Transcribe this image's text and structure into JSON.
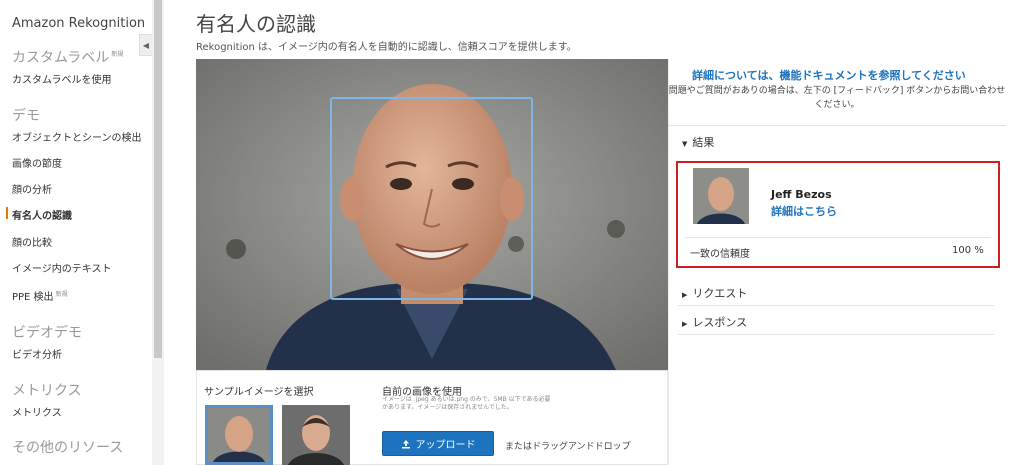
{
  "sidebar": {
    "brand": "Amazon Rekognition",
    "new_badge": "新規",
    "collapse_icon": "◀",
    "sections": [
      {
        "title": "カスタムラベル",
        "items": [
          "カスタムラベルを使用"
        ]
      },
      {
        "title": "デモ",
        "items": [
          "オブジェクトとシーンの検出",
          "画像の節度",
          "顔の分析",
          "有名人の認識",
          "顔の比較",
          "イメージ内のテキスト",
          "PPE 検出"
        ]
      },
      {
        "title": "ビデオデモ",
        "items": [
          "ビデオ分析"
        ]
      },
      {
        "title": "メトリクス",
        "items": [
          "メトリクス"
        ]
      },
      {
        "title": "その他のリソース",
        "items": []
      }
    ],
    "active_item": "有名人の認識"
  },
  "main": {
    "title": "有名人の認識",
    "subtitle": "Rekognition は、イメージ内の有名人を自動的に認識し、信頼スコアを提供します。",
    "sample_label": "サンプルイメージを選択",
    "upload_title": "自前の画像を使用",
    "upload_note": "イメージは .jpeg あるいは.png のみで、5MB 以下である必要があります。イメージは保存されませんでした。",
    "upload_button": "アップロード",
    "upload_icon": "upload-icon",
    "upload_alt": "またはドラッグアンドドロップ"
  },
  "right": {
    "doc_link": "詳細については、機能ドキュメントを参照してください",
    "help_text": "問題やご質問がおありの場合は、左下の [フィードバック] ボタンからお問い合わせください。",
    "results_label": "結果",
    "celebrity_name": "Jeff Bezos",
    "details_link": "詳細はこちら",
    "confidence_label": "一致の信頼度",
    "confidence_value": "100 %",
    "request_label": "リクエスト",
    "response_label": "レスポンス"
  },
  "colors": {
    "accent": "#1e73be",
    "highlight": "#cc1f1f",
    "face_box": "#7fb6e8",
    "active_marker": "#e07b00"
  }
}
